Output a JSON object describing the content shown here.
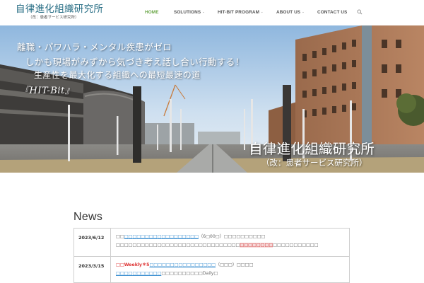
{
  "header": {
    "logo_title": "自律進化組織研究所",
    "logo_subtitle": "（改：患者サービス研究所）",
    "nav": [
      {
        "label": "HOME",
        "active": true,
        "dropdown": false
      },
      {
        "label": "SOLUTIONS",
        "active": false,
        "dropdown": true
      },
      {
        "label": "HIT-BIT PROGRAM",
        "active": false,
        "dropdown": true
      },
      {
        "label": "ABOUT US",
        "active": false,
        "dropdown": true
      },
      {
        "label": "CONTACT US",
        "active": false,
        "dropdown": false
      }
    ],
    "search_icon": "search-icon",
    "accent_color": "#69a645"
  },
  "hero": {
    "lines": [
      "離職・パワハラ・メンタル疾患がゼロ",
      "しかも現場がみずから気づき考え話し合い行動する！",
      "生産性を最大化する組織への最短最速の道",
      "『HIT-Bit』"
    ],
    "title": "自律進化組織研究所",
    "subtitle": "（改：患者サービス研究所）"
  },
  "news": {
    "heading": "News",
    "rows": [
      {
        "date": "2023/6/12",
        "line1": {
          "pre": "□□",
          "link": "□□□□□□□□□□□□□□□□□□",
          "post": "（6□00□）□□□□□□□□□□"
        },
        "line2": {
          "pre": "□□□□□□□□□□□□□□□□□□□□□□□□□□□□□□",
          "red": "□□□□□□□□",
          "post": "□□□□□□□□□□□"
        }
      },
      {
        "date": "2023/3/15",
        "line1": {
          "red": "□□Weekly＊5",
          "link": "□□□□□□□□□□□□□□□□",
          "post": "（□□□）□□□□"
        },
        "line2": {
          "link": "□□□□□□□□□□□",
          "post": "□□□□□□□□□□Daily□"
        }
      },
      {
        "date": "",
        "line1": {
          "pre": ""
        },
        "line2": {
          "pre": ""
        }
      }
    ]
  }
}
